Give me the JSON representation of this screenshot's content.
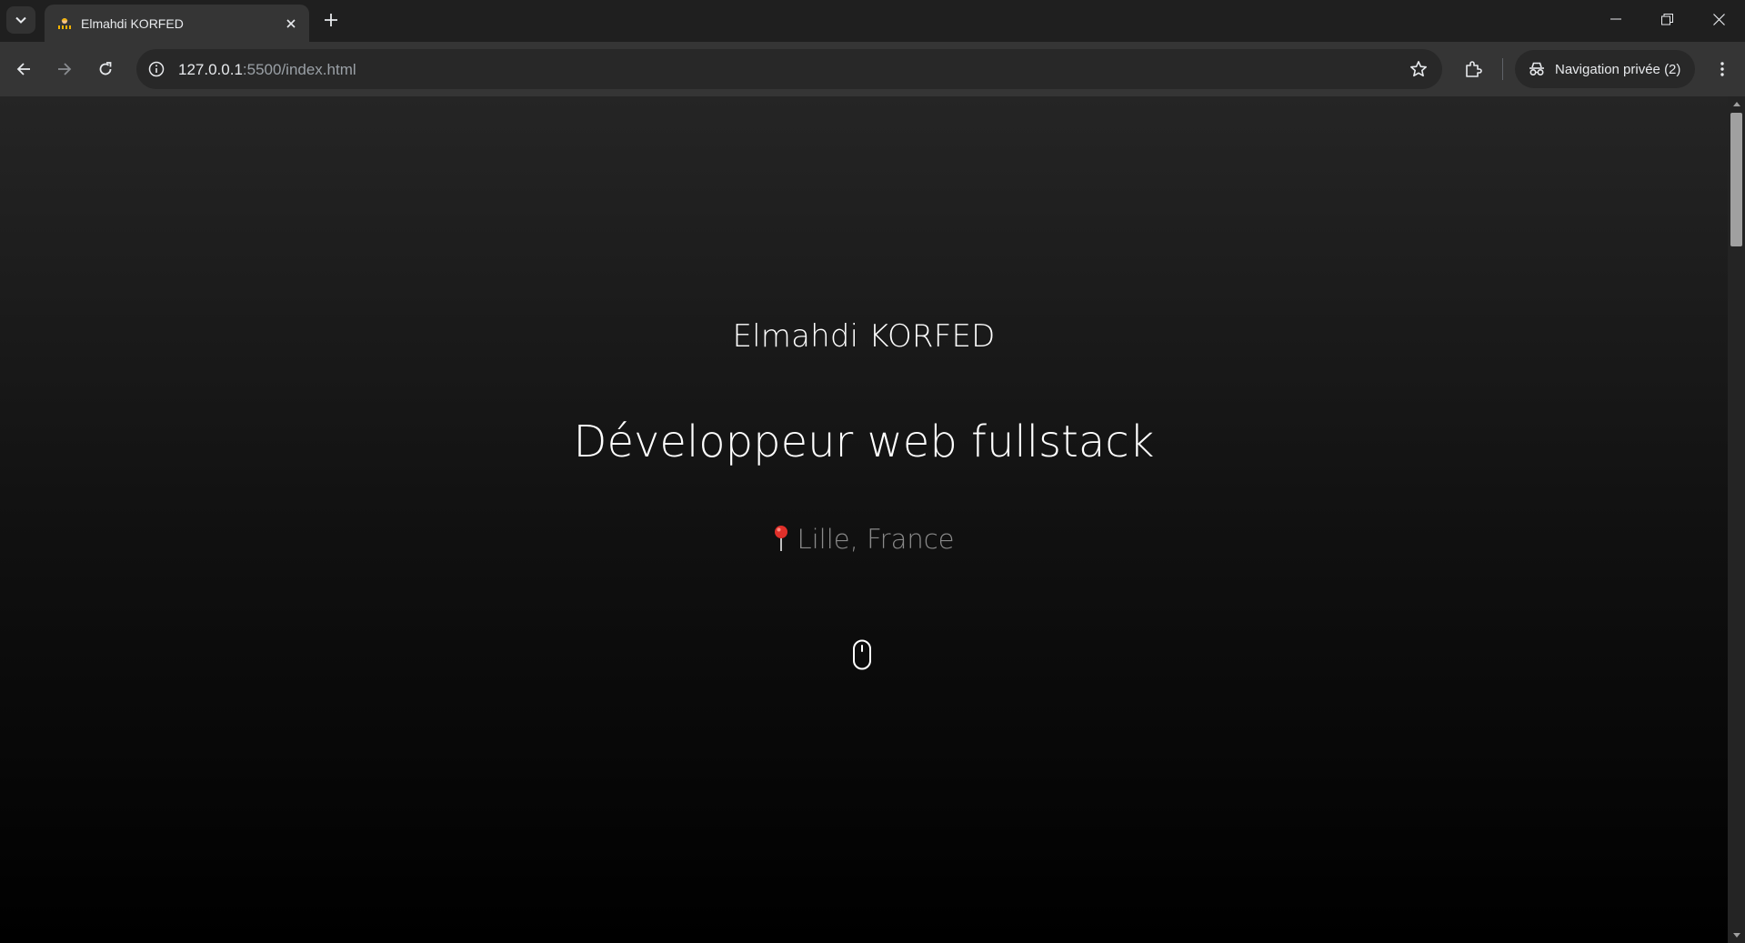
{
  "browser": {
    "tab": {
      "title": "Elmahdi KORFED",
      "favicon": "construction-icon"
    },
    "address_bar": {
      "host": "127.0.0.1",
      "rest": ":5500/index.html"
    },
    "incognito": {
      "label": "Navigation privée (2)"
    },
    "icons": [
      "tab-search-icon",
      "close-icon",
      "plus-icon",
      "minimize-icon",
      "restore-icon",
      "close-window-icon",
      "back-arrow-icon",
      "forward-arrow-icon",
      "reload-icon",
      "info-icon",
      "star-icon",
      "extensions-icon",
      "incognito-icon",
      "kebab-menu-icon"
    ]
  },
  "page": {
    "name": "Elmahdi KORFED",
    "title": "Développeur web fullstack",
    "location": "Lille, France",
    "location_icon": "pin-icon",
    "scroll_icon": "mouse-icon"
  },
  "colors": {
    "tabstrip": "#1f1f1f",
    "toolbar": "#353535",
    "omnibox": "#282828",
    "page_top": "#252525",
    "page_bottom": "#000000",
    "pin": "#e0302a",
    "location_text": "#8a8a8a"
  }
}
